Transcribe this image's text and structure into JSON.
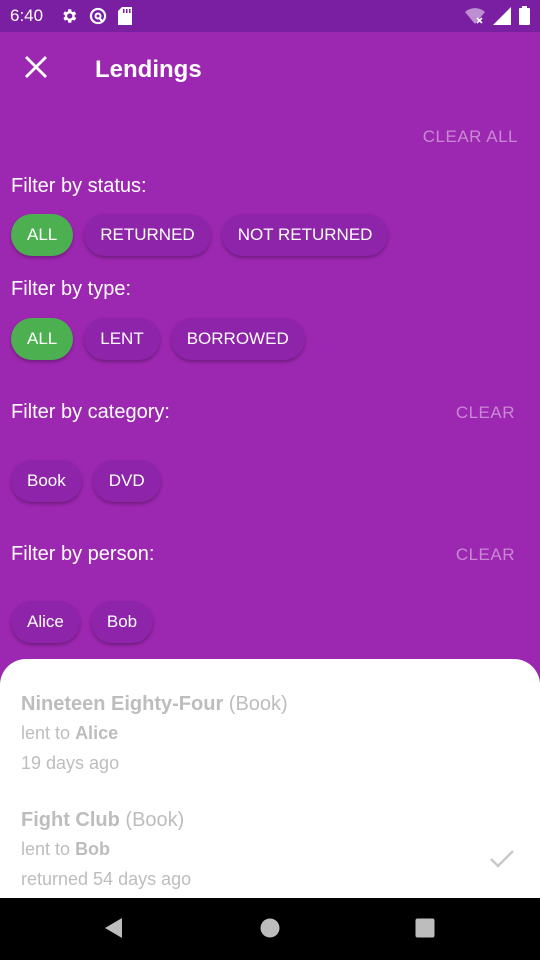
{
  "status_bar": {
    "time": "6:40",
    "icons_left": [
      "gear-icon",
      "at-sign-icon",
      "sd-card-icon"
    ],
    "icons_right": [
      "wifi-off-icon",
      "signal-icon",
      "battery-icon"
    ]
  },
  "app_bar": {
    "title": "Lendings",
    "close_icon": "close-icon"
  },
  "clear_all_label": "CLEAR ALL",
  "filters": {
    "status": {
      "label": "Filter by status:",
      "chips": [
        {
          "label": "ALL",
          "selected": true
        },
        {
          "label": "RETURNED",
          "selected": false
        },
        {
          "label": "NOT RETURNED",
          "selected": false
        }
      ]
    },
    "type": {
      "label": "Filter by type:",
      "chips": [
        {
          "label": "ALL",
          "selected": true
        },
        {
          "label": "LENT",
          "selected": false
        },
        {
          "label": "BORROWED",
          "selected": false
        }
      ]
    },
    "category": {
      "label": "Filter by category:",
      "clear_label": "CLEAR",
      "chips": [
        {
          "label": "Book",
          "selected": false
        },
        {
          "label": "DVD",
          "selected": false
        }
      ]
    },
    "person": {
      "label": "Filter by person:",
      "clear_label": "CLEAR",
      "chips": [
        {
          "label": "Alice",
          "selected": false
        },
        {
          "label": "Bob",
          "selected": false
        }
      ]
    }
  },
  "lendings": [
    {
      "title": "Nineteen Eighty-Four",
      "type": "(Book)",
      "direction": "lent to",
      "person": "Alice",
      "date": "19 days ago",
      "returned": false
    },
    {
      "title": "Fight Club",
      "type": "(Book)",
      "direction": "lent to",
      "person": "Bob",
      "date": "returned 54 days ago",
      "returned": true
    }
  ],
  "colors": {
    "primary": "#9c27b0",
    "status_bar": "#7b1fa2",
    "chip": "#8e24aa",
    "chip_selected": "#4caf50"
  },
  "nav_bar": {
    "icons": [
      "back-icon",
      "home-icon",
      "recents-icon"
    ]
  }
}
